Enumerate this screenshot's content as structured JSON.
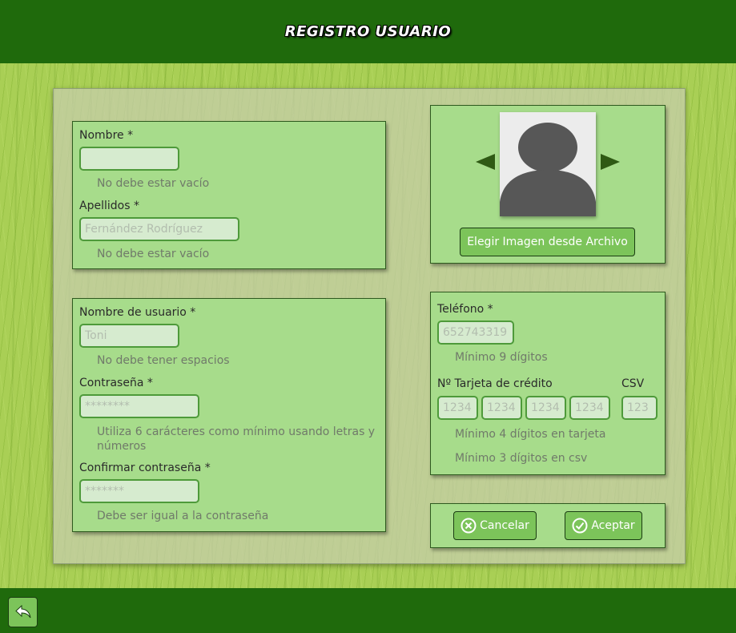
{
  "header": {
    "title": "REGISTRO USUARIO"
  },
  "personal": {
    "nombre_label": "Nombre *",
    "nombre_value": "",
    "nombre_placeholder": "",
    "nombre_hint": "No debe estar vacío",
    "apellidos_label": "Apellidos *",
    "apellidos_placeholder": "Fernández Rodríguez",
    "apellidos_hint": "No debe estar vacío"
  },
  "account": {
    "usuario_label": "Nombre de usuario *",
    "usuario_placeholder": "Toni",
    "usuario_hint": "No debe tener espacios",
    "password_label": "Contraseña *",
    "password_placeholder": "********",
    "password_hint": "Utiliza 6 carácteres como mínimo usando letras y números",
    "confirm_label": "Confirmar contraseña *",
    "confirm_placeholder": "*******",
    "confirm_hint": "Debe ser igual a la contraseña"
  },
  "image": {
    "choose_button": "Elegir Imagen desde Archivo"
  },
  "payment": {
    "telefono_label": "Teléfono *",
    "telefono_placeholder": "652743319",
    "telefono_hint": "Mínimo 9 dígitos",
    "tarjeta_label": "Nº Tarjeta de crédito",
    "csv_label": "CSV",
    "card_placeholders": [
      "1234",
      "1234",
      "1234",
      "1234"
    ],
    "csv_placeholder": "123",
    "tarjeta_hint": "Mínimo 4 dígitos en tarjeta",
    "csv_hint": "Mínimo 3 dígitos en csv"
  },
  "actions": {
    "cancel_label": "Cancelar",
    "accept_label": "Aceptar"
  },
  "colors": {
    "bar": "#1f6a0c",
    "box": "#a7dc8b",
    "button": "#7cc45a",
    "field_border": "#4e9a3a"
  },
  "icons": {
    "back": "back-arrow-icon",
    "prev": "triangle-left-icon",
    "next": "triangle-right-icon",
    "cancel": "circle-x-icon",
    "accept": "circle-check-icon"
  }
}
